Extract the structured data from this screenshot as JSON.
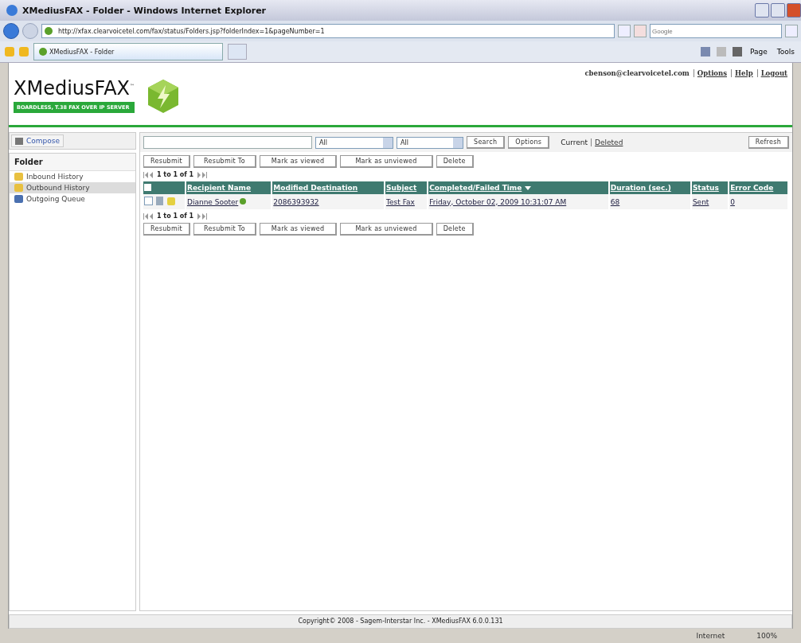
{
  "window": {
    "title": "XMediusFAX - Folder - Windows Internet Explorer"
  },
  "address_bar": {
    "url": "http://xfax.clearvoicetel.com/fax/status/Folders.jsp?folderIndex=1&pageNumber=1",
    "search_placeholder": "Google"
  },
  "browser_tab": {
    "title": "XMediusFAX - Folder"
  },
  "command_bar": {
    "items": [
      "Page",
      "Tools"
    ]
  },
  "header": {
    "logo": "XMediusFAX",
    "logo_mark": "™",
    "tagline": "BOARDLESS, T.38 FAX OVER IP SERVER",
    "user": "cbenson@clearvoicetel.com",
    "links": [
      "Options",
      "Help",
      "Logout"
    ]
  },
  "sidebar": {
    "compose": "Compose",
    "title": "Folder",
    "items": [
      {
        "label": "Inbound History",
        "selected": false
      },
      {
        "label": "Outbound History",
        "selected": true
      },
      {
        "label": "Outgoing Queue",
        "selected": false
      }
    ]
  },
  "filter": {
    "select_1": "All",
    "select_2": "All",
    "buttons": [
      "Search",
      "Options"
    ],
    "views": [
      {
        "label": "Current",
        "selected": true
      },
      {
        "label": "Deleted",
        "selected": false
      }
    ],
    "refresh": "Refresh"
  },
  "top_actions": [
    "Resubmit",
    "Resubmit To",
    "Mark as viewed",
    "Mark as unviewed",
    "Delete"
  ],
  "top_pager": "1 to 1 of 1",
  "table": {
    "select_all_checked": false,
    "columns": [
      {
        "label": "Recipient Name",
        "sorted": false
      },
      {
        "label": "Modified Destination",
        "sorted": false
      },
      {
        "label": "Subject",
        "sorted": false
      },
      {
        "label": "Completed/Failed Time",
        "sorted": true
      },
      {
        "label": "Duration (sec.)",
        "sorted": false
      },
      {
        "label": "Status",
        "sorted": false
      },
      {
        "label": "Error Code",
        "sorted": false
      }
    ],
    "rows": [
      {
        "checked": false,
        "cells": [
          "Dianne Sooter",
          "2086393932",
          "Test Fax",
          "Friday, October 02, 2009 10:31:07 AM",
          "68",
          "Sent",
          "0"
        ]
      }
    ]
  },
  "bottom_pager": "1 to 1 of 1",
  "bottom_actions": [
    "Resubmit",
    "Resubmit To",
    "Mark as viewed",
    "Mark as unviewed",
    "Delete"
  ],
  "footer": "Copyright© 2008 - Sagem-Interstar Inc. - XMediusFAX 6.0.0.131",
  "status_bar": {
    "zone": "Internet",
    "zoom": "100%"
  }
}
